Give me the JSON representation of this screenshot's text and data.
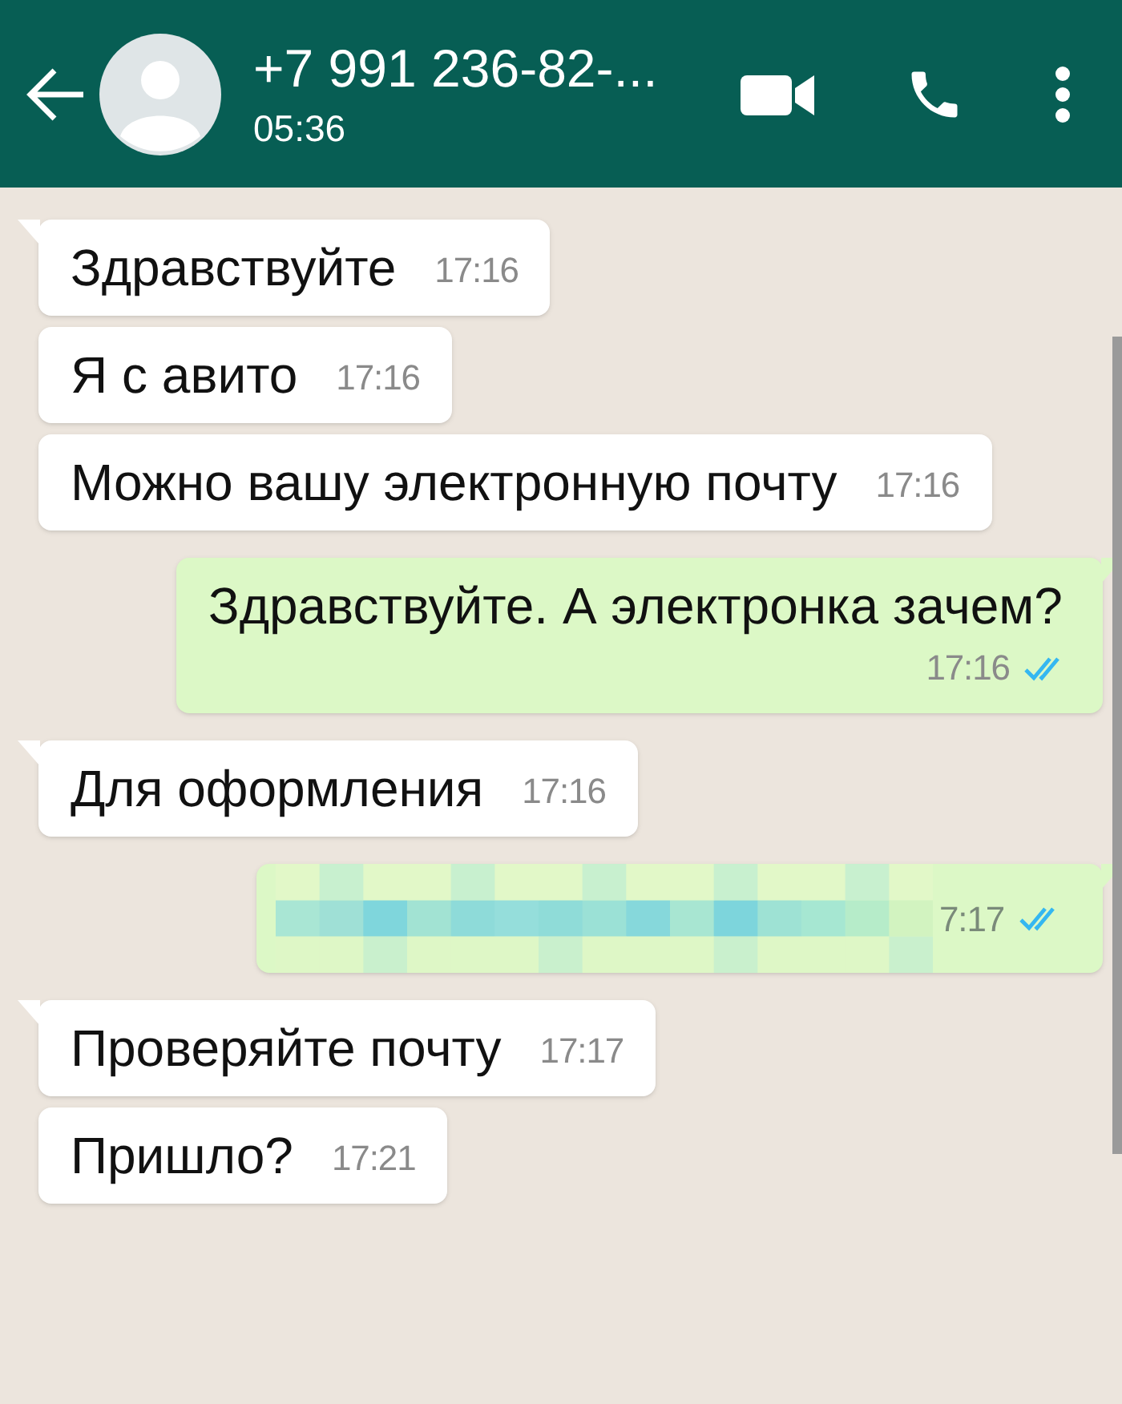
{
  "header": {
    "name": "+7 991 236-82-...",
    "status": "05:36"
  },
  "messages": [
    {
      "kind": "incoming",
      "text": "Здравствуйте",
      "time": "17:16",
      "tail": true
    },
    {
      "kind": "incoming",
      "text": "Я с авито",
      "time": "17:16",
      "tail": false
    },
    {
      "kind": "incoming",
      "text": "Можно вашу электронную почту",
      "time": "17:16",
      "tail": false
    },
    {
      "kind": "outgoing",
      "text": "Здравствуйте. А электронка зачем?",
      "time": "17:16",
      "tail": true,
      "read": true
    },
    {
      "kind": "incoming",
      "text": "Для оформления",
      "time": "17:16",
      "tail": true
    },
    {
      "kind": "redacted",
      "time": "7:17",
      "tail": true,
      "read": true
    },
    {
      "kind": "incoming",
      "text": "Проверяйте почту",
      "time": "17:17",
      "tail": true
    },
    {
      "kind": "incoming",
      "text": "Пришло?",
      "time": "17:21",
      "tail": false
    }
  ]
}
